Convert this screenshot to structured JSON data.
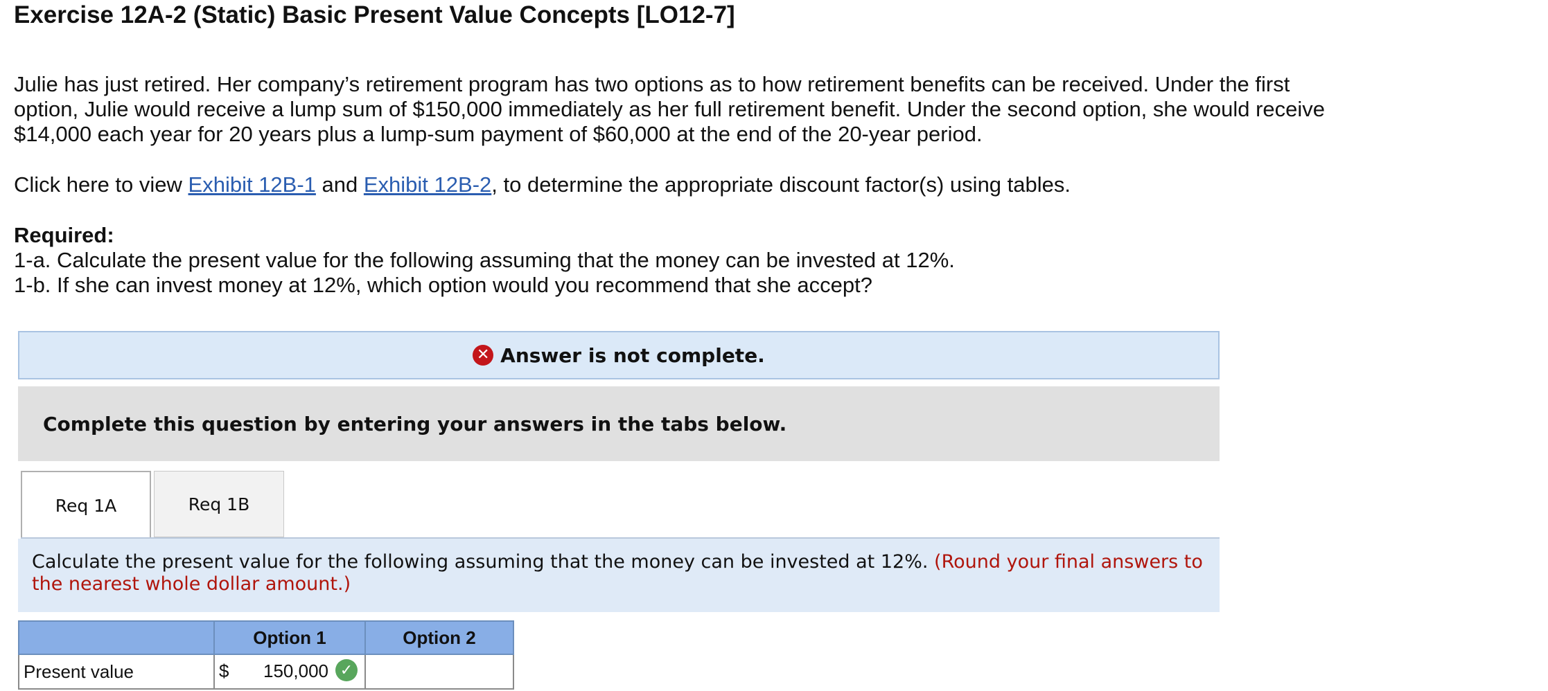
{
  "title": "Exercise 12A-2 (Static) Basic Present Value Concepts [LO12-7]",
  "problem": {
    "paragraph": "Julie has just retired. Her company’s retirement program has two options as to how retirement benefits can be received. Under the first option, Julie would receive a lump sum of $150,000 immediately as her full retirement benefit. Under the second option, she would receive $14,000 each year for 20 years plus a lump-sum payment of $60,000 at the end of the 20-year period.",
    "exhibit_prefix": "Click here to view ",
    "exhibit_1": "Exhibit 12B-1",
    "exhibit_and": " and ",
    "exhibit_2": "Exhibit 12B-2",
    "exhibit_suffix": ", to determine the appropriate discount factor(s) using tables."
  },
  "required": {
    "heading": "Required:",
    "item_1a": "1-a. Calculate the present value for the following assuming that the money can be invested at 12%.",
    "item_1b": "1-b. If she can invest money at 12%, which option would you recommend that she accept?"
  },
  "banner": {
    "text": "Answer is not complete.",
    "icon": "x-circle-icon",
    "color": "#c3161b"
  },
  "instruction": "Complete this question by entering your answers in the tabs below.",
  "tabs": [
    {
      "label": "Req 1A",
      "active": true
    },
    {
      "label": "Req 1B",
      "active": false
    }
  ],
  "prompt": {
    "text": "Calculate the present value for the following assuming that the money can be invested at 12%.",
    "note": "(Round your final answers to the nearest whole dollar amount.)"
  },
  "table": {
    "headers": [
      "",
      "Option 1",
      "Option 2"
    ],
    "rows": [
      {
        "label": "Present value",
        "option1_currency": "$",
        "option1_value": "150,000",
        "option1_correct": true,
        "option2_value": ""
      }
    ]
  }
}
